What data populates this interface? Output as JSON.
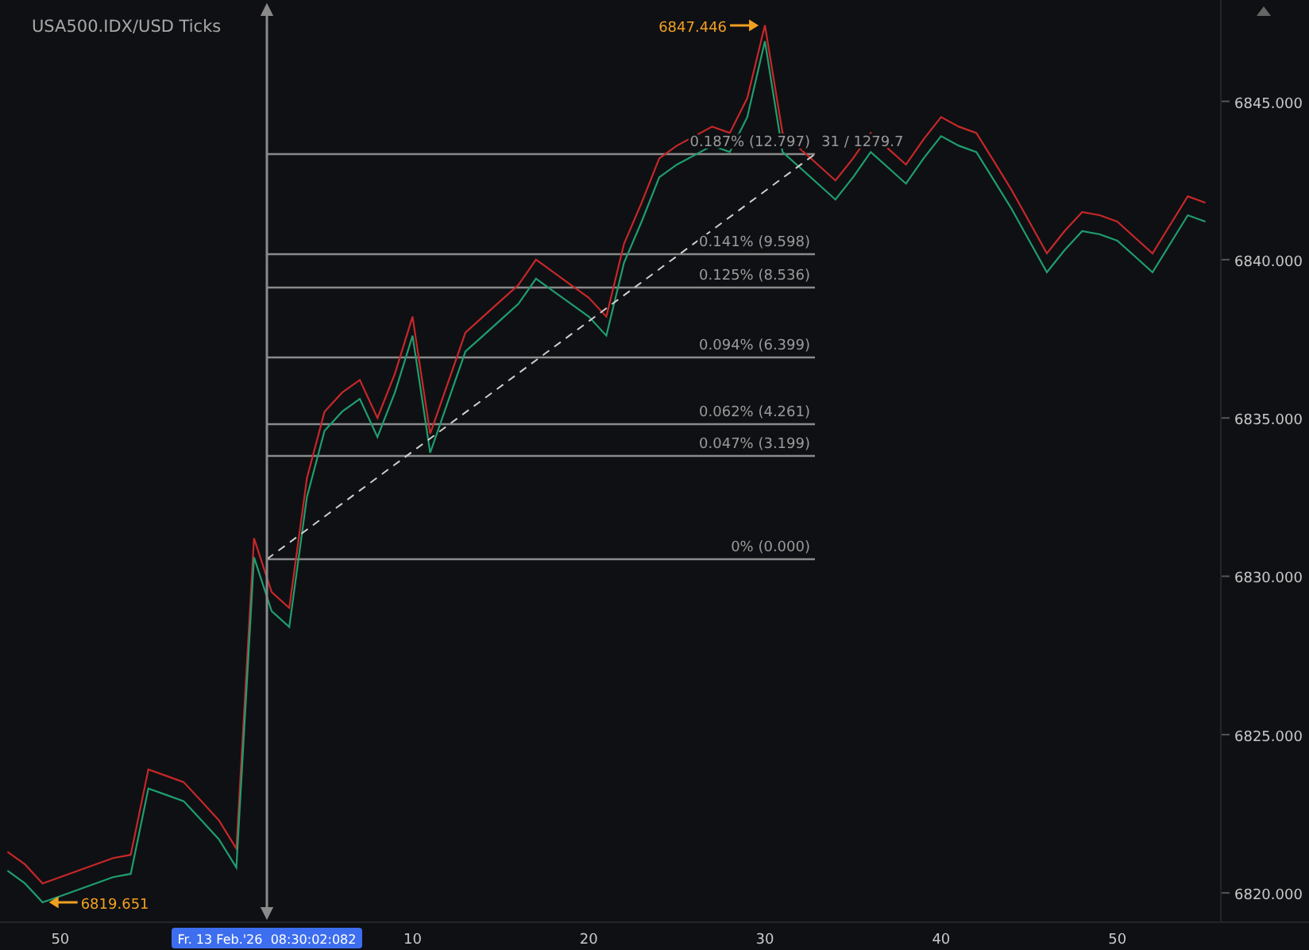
{
  "title": "USA500.IDX/USD Ticks",
  "chart_data": {
    "type": "line",
    "categories": [
      null,
      null,
      null,
      "50",
      null,
      null,
      null,
      null,
      null,
      null,
      null,
      null,
      null,
      null,
      null,
      null,
      null,
      null,
      null,
      null,
      null,
      null,
      null,
      "10",
      null,
      null,
      null,
      null,
      null,
      null,
      null,
      null,
      null,
      "20",
      null,
      null,
      null,
      null,
      null,
      null,
      null,
      null,
      null,
      "30",
      null,
      null,
      null,
      null,
      null,
      null,
      null,
      null,
      null,
      "40",
      null,
      null,
      null,
      null,
      null,
      null,
      null,
      null,
      null,
      "50",
      null,
      null,
      null,
      null,
      null
    ],
    "series": [
      {
        "color": "#c62828",
        "values": [
          6821.3,
          6820.9,
          6820.3,
          6820.5,
          6820.7,
          6820.9,
          6821.1,
          6821.2,
          6823.9,
          6823.7,
          6823.5,
          6822.9,
          6822.3,
          6821.4,
          6831.2,
          6829.5,
          6829.0,
          6833.1,
          6835.2,
          6835.8,
          6836.2,
          6835.0,
          6836.4,
          6838.2,
          6834.5,
          6836.1,
          6837.7,
          6838.2,
          6838.7,
          6839.2,
          6840.0,
          6839.6,
          6839.2,
          6838.8,
          6838.2,
          6840.5,
          6841.8,
          6843.2,
          6843.6,
          6843.9,
          6844.2,
          6844.0,
          6845.1,
          6847.4,
          6844.0,
          6843.5,
          6843.0,
          6842.5,
          6843.2,
          6844.0,
          6843.5,
          6843.0,
          6843.8,
          6844.5,
          6844.2,
          6844.0,
          6843.1,
          6842.2,
          6841.2,
          6840.2,
          6840.9,
          6841.5,
          6841.4,
          6841.2,
          6840.7,
          6840.2,
          6841.1,
          6842.0,
          6841.8
        ]
      },
      {
        "color": "#1f9e6e",
        "values": [
          6820.7,
          6820.3,
          6819.7,
          6819.9,
          6820.1,
          6820.3,
          6820.5,
          6820.6,
          6823.3,
          6823.1,
          6822.9,
          6822.3,
          6821.7,
          6820.8,
          6830.6,
          6828.9,
          6828.4,
          6832.5,
          6834.6,
          6835.2,
          6835.6,
          6834.4,
          6835.8,
          6837.6,
          6833.9,
          6835.5,
          6837.1,
          6837.6,
          6838.1,
          6838.6,
          6839.4,
          6839.0,
          6838.6,
          6838.2,
          6837.6,
          6839.9,
          6841.2,
          6842.6,
          6843.0,
          6843.3,
          6843.6,
          6843.4,
          6844.5,
          6846.9,
          6843.4,
          6842.9,
          6842.4,
          6841.9,
          6842.6,
          6843.4,
          6842.9,
          6842.4,
          6843.2,
          6843.9,
          6843.6,
          6843.4,
          6842.5,
          6841.6,
          6840.6,
          6839.6,
          6840.3,
          6840.9,
          6840.8,
          6840.6,
          6840.1,
          6839.6,
          6840.5,
          6841.4,
          6841.2
        ]
      }
    ],
    "ylim": [
      6819.1,
      6848.2
    ],
    "yticks": [
      {
        "value": 6820,
        "label": "6820.000"
      },
      {
        "value": 6825,
        "label": "6825.000"
      },
      {
        "value": 6830,
        "label": "6830.000"
      },
      {
        "value": 6835,
        "label": "6835.000"
      },
      {
        "value": 6840,
        "label": "6840.000"
      },
      {
        "value": 6845,
        "label": "6845.000"
      }
    ]
  },
  "fib_tool": {
    "levels": [
      "0.187% (12.797)",
      "0.141% (9.598)",
      "0.125% (8.536)",
      "0.094% (6.399)",
      "0.062% (4.261)",
      "0.047% (3.199)",
      "0% (0.000)"
    ],
    "trend_label": "31 / 1279.7"
  },
  "max_label": "6847.446",
  "min_label": "6819.651",
  "crosshair_label": "Fr. 13 Feb.'26  08:30:02:082"
}
